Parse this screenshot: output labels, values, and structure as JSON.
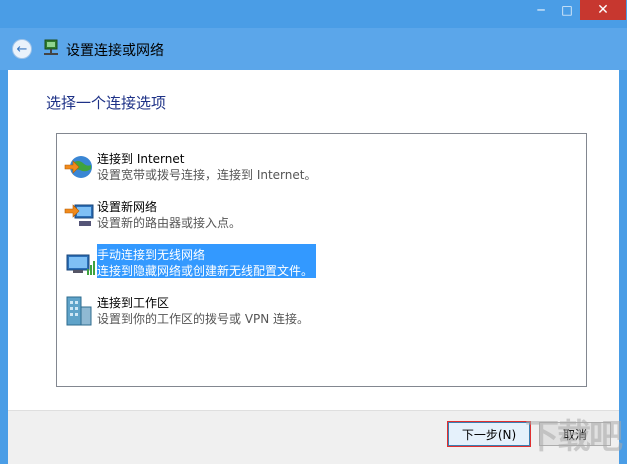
{
  "window": {
    "controls": {
      "minimize": "─",
      "maximize": "□",
      "close": "✕"
    }
  },
  "header": {
    "back_icon": "back-arrow-icon",
    "title": "设置连接或网络"
  },
  "main": {
    "subtitle": "选择一个连接选项",
    "options": [
      {
        "title": "连接到 Internet",
        "desc": "设置宽带或拨号连接，连接到 Internet。",
        "icon": "globe-connection-icon"
      },
      {
        "title": "设置新网络",
        "desc": "设置新的路由器或接入点。",
        "icon": "new-network-icon"
      },
      {
        "title": "手动连接到无线网络",
        "desc": "连接到隐藏网络或创建新无线配置文件。",
        "icon": "wireless-network-icon",
        "selected": true
      },
      {
        "title": "连接到工作区",
        "desc": "设置到你的工作区的拨号或 VPN 连接。",
        "icon": "workplace-icon"
      }
    ]
  },
  "footer": {
    "next_label": "下一步(N)",
    "cancel_label": "取消"
  },
  "watermark": "下载吧",
  "colors": {
    "accent": "#3399ff",
    "titlebar": "#4a9de6",
    "close": "#c7372f",
    "subtitle": "#1e3287"
  }
}
